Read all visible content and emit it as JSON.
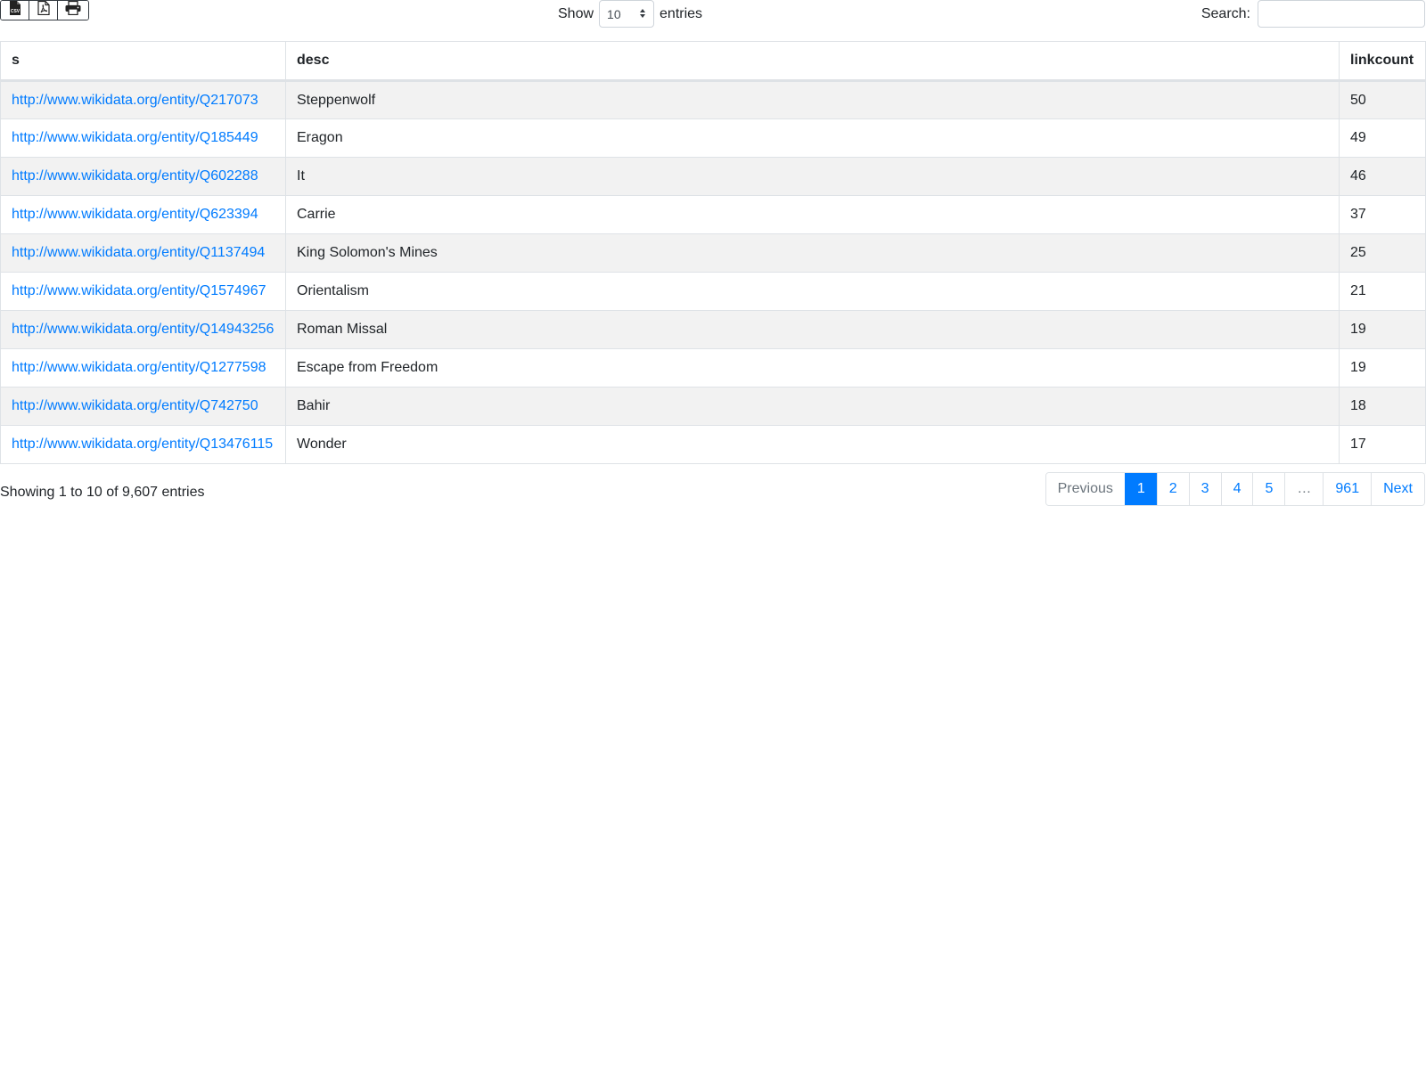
{
  "toolbar": {
    "export_buttons": [
      {
        "icon": "csv-file-icon",
        "label": "CSV"
      },
      {
        "icon": "pdf-file-icon"
      },
      {
        "icon": "print-icon"
      }
    ]
  },
  "length": {
    "prefix": "Show",
    "value": "10",
    "suffix": "entries"
  },
  "search": {
    "label": "Search:",
    "value": "",
    "placeholder": ""
  },
  "table": {
    "columns": [
      "s",
      "desc",
      "linkcount"
    ],
    "rows": [
      {
        "s": "http://www.wikidata.org/entity/Q217073",
        "desc": "Steppenwolf",
        "linkcount": "50"
      },
      {
        "s": "http://www.wikidata.org/entity/Q185449",
        "desc": "Eragon",
        "linkcount": "49"
      },
      {
        "s": "http://www.wikidata.org/entity/Q602288",
        "desc": "It",
        "linkcount": "46"
      },
      {
        "s": "http://www.wikidata.org/entity/Q623394",
        "desc": "Carrie",
        "linkcount": "37"
      },
      {
        "s": "http://www.wikidata.org/entity/Q1137494",
        "desc": "King Solomon's Mines",
        "linkcount": "25"
      },
      {
        "s": "http://www.wikidata.org/entity/Q1574967",
        "desc": "Orientalism",
        "linkcount": "21"
      },
      {
        "s": "http://www.wikidata.org/entity/Q14943256",
        "desc": "Roman Missal",
        "linkcount": "19"
      },
      {
        "s": "http://www.wikidata.org/entity/Q1277598",
        "desc": "Escape from Freedom",
        "linkcount": "19"
      },
      {
        "s": "http://www.wikidata.org/entity/Q742750",
        "desc": "Bahir",
        "linkcount": "18"
      },
      {
        "s": "http://www.wikidata.org/entity/Q13476115",
        "desc": "Wonder",
        "linkcount": "17"
      }
    ]
  },
  "info": "Showing 1 to 10 of 9,607 entries",
  "pagination": {
    "previous": "Previous",
    "pages": [
      "1",
      "2",
      "3",
      "4",
      "5",
      "…",
      "961"
    ],
    "active": "1",
    "next": "Next"
  },
  "colors": {
    "link": "#007bff",
    "active_page": "#007bff",
    "stripe": "#f2f2f2"
  }
}
